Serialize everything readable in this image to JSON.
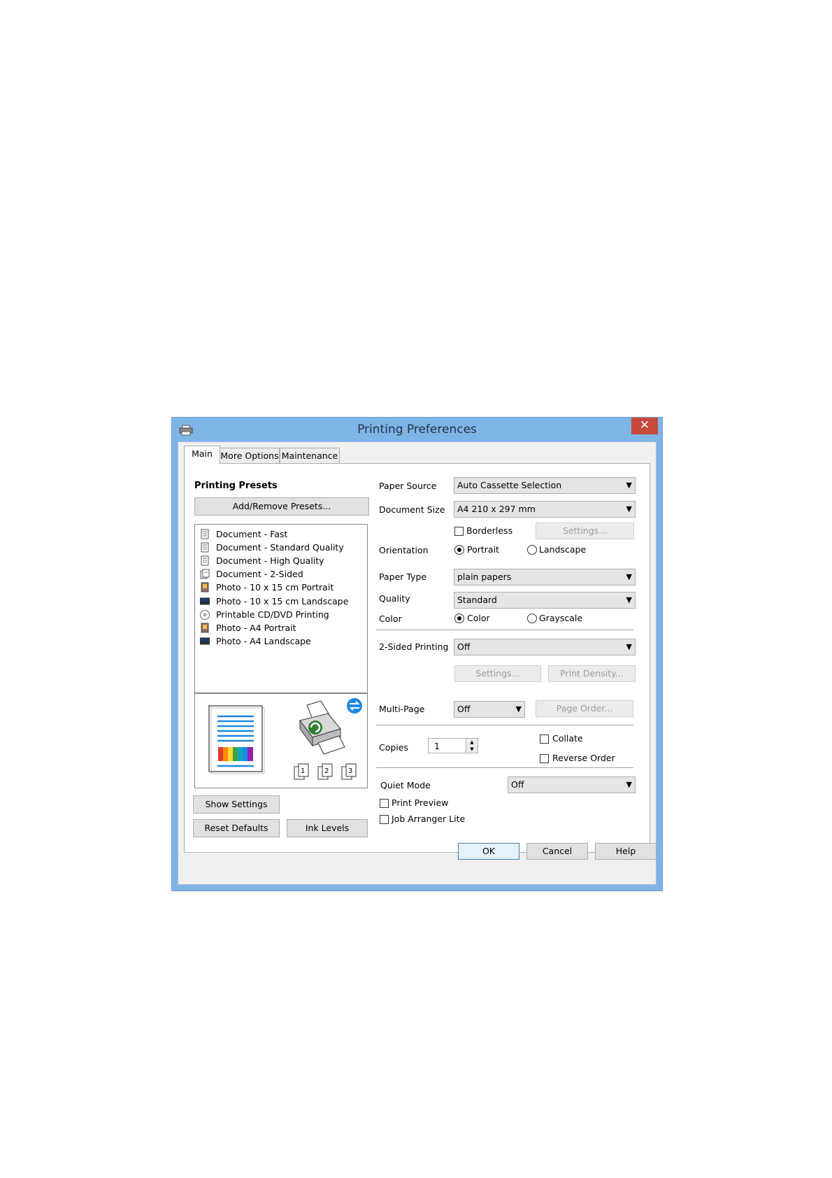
{
  "window": {
    "title": "Printing Preferences",
    "close_glyph": "✕"
  },
  "tabs": [
    {
      "label": "Main",
      "active": true
    },
    {
      "label": "More Options",
      "active": false
    },
    {
      "label": "Maintenance",
      "active": false
    }
  ],
  "presets": {
    "heading": "Printing Presets",
    "add_remove_label": "Add/Remove Presets...",
    "items": [
      {
        "label": "Document - Fast",
        "icon": "document-icon"
      },
      {
        "label": "Document - Standard Quality",
        "icon": "document-icon"
      },
      {
        "label": "Document - High Quality",
        "icon": "document-icon"
      },
      {
        "label": "Document - 2-Sided",
        "icon": "document-2sided-icon"
      },
      {
        "label": "Photo - 10 x 15 cm Portrait",
        "icon": "photo-portrait-icon"
      },
      {
        "label": "Photo - 10 x 15 cm Landscape",
        "icon": "photo-landscape-icon"
      },
      {
        "label": "Printable CD/DVD Printing",
        "icon": "cd-icon"
      },
      {
        "label": "Photo - A4 Portrait",
        "icon": "photo-portrait-icon"
      },
      {
        "label": "Photo - A4 Landscape",
        "icon": "photo-landscape-icon"
      }
    ]
  },
  "preview": {
    "page_numbers": [
      "1",
      "2",
      "3"
    ]
  },
  "left_buttons": {
    "show_settings": "Show Settings",
    "reset_defaults": "Reset Defaults",
    "ink_levels": "Ink Levels"
  },
  "settings": {
    "paper_source": {
      "label": "Paper Source",
      "value": "Auto Cassette Selection"
    },
    "document_size": {
      "label": "Document Size",
      "value": "A4 210 x 297 mm"
    },
    "borderless": {
      "label": "Borderless",
      "checked": false
    },
    "borderless_settings": "Settings...",
    "orientation": {
      "label": "Orientation",
      "portrait": "Portrait",
      "landscape": "Landscape",
      "selected": "Portrait"
    },
    "paper_type": {
      "label": "Paper Type",
      "value": "plain papers"
    },
    "quality": {
      "label": "Quality",
      "value": "Standard"
    },
    "color": {
      "label": "Color",
      "color": "Color",
      "grayscale": "Grayscale",
      "selected": "Color"
    },
    "two_sided": {
      "label": "2-Sided Printing",
      "value": "Off",
      "settings": "Settings...",
      "print_density": "Print Density..."
    },
    "multi_page": {
      "label": "Multi-Page",
      "value": "Off",
      "page_order": "Page Order..."
    },
    "copies": {
      "label": "Copies",
      "value": "1"
    },
    "collate": {
      "label": "Collate",
      "checked": false
    },
    "reverse_order": {
      "label": "Reverse Order",
      "checked": false
    },
    "quiet_mode": {
      "label": "Quiet Mode",
      "value": "Off"
    },
    "print_preview": {
      "label": "Print Preview",
      "checked": false
    },
    "job_arranger": {
      "label": "Job Arranger Lite",
      "checked": false
    }
  },
  "footer": {
    "ok": "OK",
    "cancel": "Cancel",
    "help": "Help"
  },
  "colors": {
    "title_bar": "#7fb4e6",
    "close_button": "#c7483c",
    "accent_blue": "#1e88e5"
  }
}
